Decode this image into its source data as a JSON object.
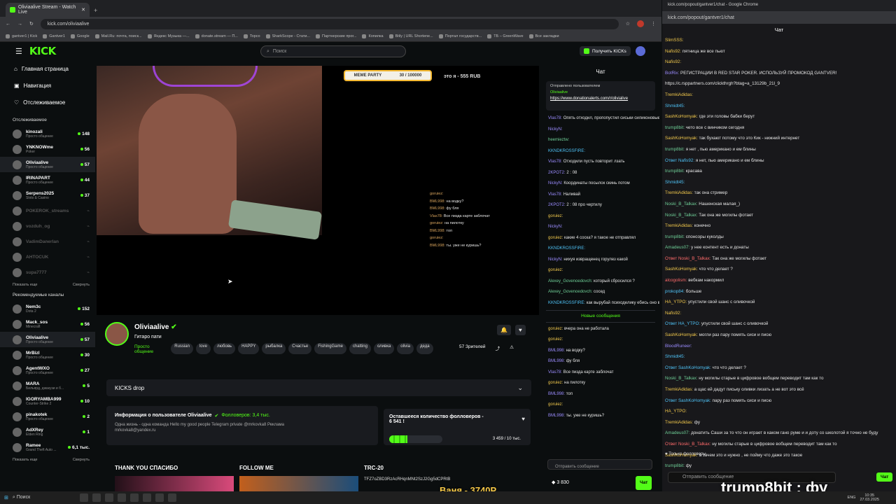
{
  "browser_left": {
    "tab_title": "Oliviaalive Stream - Watch Live",
    "url": "kick.com/oliviaalive",
    "bookmarks": [
      "gantver1 | Kick",
      "Gantver1",
      "Google",
      "Mail.Ru: почта, поиск...",
      "Яндекс Музыка —...",
      "donate.stream — П...",
      "Topco",
      "SharkScope - Стати...",
      "Партнерские прог...",
      "Копилка",
      "Bitly | URL Shortene...",
      "Портал государств...",
      "ТБ – GreenWave",
      "Все закладки"
    ]
  },
  "kick": {
    "logo": "KICK",
    "search_placeholder": "Поиск",
    "kicks_button": "Получить KICKs",
    "nav": [
      "Главная страница",
      "Навигация",
      "Отслеживаемое"
    ],
    "following_header": "Отслеживаемое",
    "following": [
      {
        "name": "kinozali",
        "cat": "Просто общение",
        "viewers": "148",
        "live": true
      },
      {
        "name": "YNKNOWme",
        "cat": "Poker",
        "viewers": "56",
        "live": true
      },
      {
        "name": "Oliviaalive",
        "cat": "Просто общение",
        "viewers": "57",
        "live": true,
        "sel": true
      },
      {
        "name": "IRINAPART",
        "cat": "Просто общение",
        "viewers": "44",
        "live": true
      },
      {
        "name": "Serpens2025",
        "cat": "Slots & Casino",
        "viewers": "37",
        "live": true
      },
      {
        "name": "POKEROK_streams",
        "cat": "",
        "viewers": "",
        "live": false
      },
      {
        "name": "vozduh_og",
        "cat": "",
        "viewers": "",
        "live": false
      },
      {
        "name": "VadimDanerlan",
        "cat": "",
        "viewers": "",
        "live": false
      },
      {
        "name": "AHTOCUK",
        "cat": "",
        "viewers": "",
        "live": false
      },
      {
        "name": "supa7777",
        "cat": "",
        "viewers": "",
        "live": false
      }
    ],
    "show_more": "Показать еще",
    "collapse": "Свернуть",
    "recommended_header": "Рекомендуемые каналы",
    "recommended": [
      {
        "name": "Nem3c",
        "cat": "Dota 2",
        "viewers": "152"
      },
      {
        "name": "Mack_sos",
        "cat": "Minecraft",
        "viewers": "56"
      },
      {
        "name": "Oliviaalive",
        "cat": "Просто общение",
        "viewers": "57",
        "sel": true
      },
      {
        "name": "MrBizl",
        "cat": "Просто общение",
        "viewers": "30"
      },
      {
        "name": "AgentWXO",
        "cat": "Просто общение",
        "viewers": "27"
      },
      {
        "name": "MARA",
        "cat": "Бильярд, джакузи и б...",
        "viewers": "5"
      },
      {
        "name": "IGORYAMBA999",
        "cat": "Counter-Strike 2",
        "viewers": "10"
      },
      {
        "name": "pinakotek",
        "cat": "Просто общение",
        "viewers": "2"
      },
      {
        "name": "AdXRey",
        "cat": "Elden Ring",
        "viewers": "1"
      },
      {
        "name": "Ramee",
        "cat": "Grand Theft Auto ...",
        "viewers": "6,1 тыс."
      }
    ],
    "show_more2": "Показать еще",
    "collapse2": "Свернуть"
  },
  "stream": {
    "overlay_top": "это я - 555 RUB",
    "meme": "MEME PARTY",
    "meme_sub": "30 / 100000",
    "overlay_chat": [
      [
        "goruiez:",
        ""
      ],
      [
        "BML998:",
        "на водку?"
      ],
      [
        "BML998:",
        "фу бля"
      ],
      [
        "Vlas78:",
        "Все пизда карте заблочат"
      ],
      [
        "goruiez:",
        "на пилотку"
      ],
      [
        "BML998:",
        "топ"
      ],
      [
        "goruiez:",
        ""
      ],
      [
        "BML998:",
        "ты. уже не куришь?"
      ]
    ],
    "channel": "Oliviaalive",
    "title": "Гитаро пати",
    "category": "Просто общение",
    "tags": [
      "Russian",
      "love",
      "любовь",
      "HAPPY",
      "рыбалка",
      "Счастье",
      "FishingGame",
      "chatting",
      "оливка",
      "olivia",
      "деда"
    ],
    "viewers": "57 Зрителей"
  },
  "panels": {
    "kicks_drop": "KICKS drop",
    "about_title": "Информация о пользователе Oliviaalive",
    "followers": "Фолловеров: 3,4 тыс.",
    "about_text1": "Одна жизнь - одна команда Hello my good people  Telegram private @mrkovka8 Реклама",
    "about_text2": "mrkovka8@yandex.ru",
    "goal_title": "Оставшееся количество фолловеров -",
    "goal_count": "6 541 !",
    "goal_progress_text": "3 459 / 10 тыс.",
    "goal_progress": 0.3459,
    "thank_you": "THANK YOU СПАСИБО",
    "follow_me": "FOLLOW ME",
    "trc": "TRC-20",
    "trc_addr": "TFZ7oZBD3RzAcRHqnMNt2SzJ2Gg5dCPRtB"
  },
  "chat": {
    "header": "Чат",
    "pinned_label": "Отправлено пользователем",
    "pinned_user": "Oliviaalive",
    "pinned_link": "https://www.donationalerts.com/r/olivialive",
    "lines": [
      [
        "Vlas78:",
        "Опять отходил, пропопустил сиськи силиконовые да ебано рот сто акое"
      ],
      [
        "NickyN:",
        ""
      ],
      [
        "heemieztw:",
        ""
      ],
      [
        "KKNDKROSSFIRE:",
        ""
      ],
      [
        "Vlas78:",
        "Отходили пусть повторит лзать"
      ],
      [
        "2KPOT2:",
        "2 : 08"
      ],
      [
        "NickyN:",
        "Координаты посылок скинь потом"
      ],
      [
        "Vlas78:",
        "Наливай"
      ],
      [
        "2KPOT2:",
        "2 : 08 про чертилу"
      ],
      [
        "goruiez:",
        ""
      ],
      [
        "NickyN:",
        ""
      ],
      [
        "goruiez:",
        "какие 4 соска? я такое не отправлял"
      ],
      [
        "KKNDKROSSFIRE:",
        ""
      ],
      [
        "NickyN:",
        "нихуя извращенец горулез какой"
      ],
      [
        "goruiez:",
        ""
      ],
      [
        "Alexey_Govenoedovch:",
        "который сбросился ?"
      ],
      [
        "Alexey_Govenoedovch:",
        "сосед"
      ],
      [
        "KKNDKROSSFIRE:",
        "как вырубай психоделику ебись оно все конем"
      ]
    ],
    "new_messages": "Новые сообщения",
    "lines2": [
      [
        "goruiez:",
        "вчера она не работала"
      ],
      [
        "goruiez:",
        ""
      ],
      [
        "BML998:",
        "на водку?"
      ],
      [
        "BML998:",
        "фу бля"
      ],
      [
        "Vlas78:",
        "Все пизда карте заблочат"
      ],
      [
        "goruiez:",
        "на пилотку"
      ],
      [
        "BML998:",
        "топ"
      ],
      [
        "goruiez:",
        ""
      ],
      [
        "BML998:",
        "ты. уже не куришь?"
      ]
    ],
    "send_placeholder": "Отправить сообщение",
    "balance": "3 830",
    "chat_button": "Чат"
  },
  "browser_right": {
    "url": "kick.com/popout/gantver1/chat",
    "title": "Чат",
    "lines": [
      [
        "SlimSSS:",
        ""
      ],
      [
        "Nafis92:",
        "пятница же все пьют"
      ],
      [
        "Nafis92:",
        ""
      ],
      [
        "BotRix:",
        "РЕГИСТРАЦИИ В RED STAR POKER. ИСПОЛЬЗУЙ ПРОМОКОД GANTVER!"
      ],
      [
        "",
        "https://c.rsppartners.com/clickthrgh?btag=a_13129b_21l_9"
      ],
      [
        "TremkiAdidas:",
        ""
      ],
      [
        "Shmidt45:",
        ""
      ],
      [
        "SashKoHomyak:",
        "где эти головы бабки берут"
      ],
      [
        "trump8bit:",
        "чето все с винчиком сегодня"
      ],
      [
        "SashKoHomyak:",
        "так бухают потому что это Кик - нижний интернет"
      ],
      [
        "trump8bit:",
        "я нет , пью американо и ем блины"
      ],
      [
        "Ответ Nafis92:",
        "я нет, пью американо и ем блины"
      ],
      [
        "trump8bit:",
        "красава"
      ],
      [
        "Shmidt45:",
        ""
      ],
      [
        "TremkiAdidas:",
        "так она стример"
      ],
      [
        "Noski_B_Talkax:",
        "Нашенская малая_)"
      ],
      [
        "Noski_B_Talkax:",
        "Так она же могилы фотает"
      ],
      [
        "TremkiAdidas:",
        "конечно"
      ],
      [
        "trump8bit:",
        "спонсоры куколды"
      ],
      [
        "Amadeus07:",
        "у нее контент есть и донаты"
      ],
      [
        "Ответ Noski_B_Talkax:",
        "Так она же могилы фотает"
      ],
      [
        "SashKoHomyak:",
        "что что делает ?"
      ],
      [
        "alcogolism:",
        "вебкам накормил"
      ],
      [
        "prokop84:",
        "больше"
      ],
      [
        "HA_YTPO:",
        "упустили свой шанс с оливочкой"
      ],
      [
        "Nafis92:",
        ""
      ],
      [
        "Ответ HA_YTPO:",
        "упустили свой шанс с оливочкой"
      ],
      [
        "SashKoHomyak:",
        "могли раз пару помять сиси и писю"
      ],
      [
        "BloodRuneer:",
        ""
      ],
      [
        "Shmidt45:",
        ""
      ],
      [
        "Ответ SashKoHomyak:",
        "что что делает ?"
      ],
      [
        "Noski_B_Talkax:",
        "ну могилы старые в цифровое вобщем переводит там как то"
      ],
      [
        "TremkiAdidas:",
        "а щас ей дадут письку оливки лизать а не вот это всё"
      ],
      [
        "Ответ SashKoHomyak:",
        "пару раз помять сиси и писю"
      ],
      [
        "HA_YTPO:",
        ""
      ],
      [
        "TremkiAdidas:",
        "фу"
      ],
      [
        "Amadeus07:",
        "донатить Саши за то что он играет в каком гано руме и и доту со школотой я точно не буду"
      ],
      [
        "Ответ Noski_B_Talkax:",
        "ну могилы старые в цифровое вобщем переводит там как то"
      ],
      [
        "SashKoHomyak:",
        "а зачем это и нужно , не пойму что даже это такое"
      ],
      [
        "trump8bit:",
        "фу"
      ]
    ],
    "followers_only": "Только фолловеры",
    "send_placeholder": "Отправить сообщение",
    "chat_button": "Чат",
    "overlay_text": "trump8bit : фу"
  },
  "taskbar": {
    "search": "Поиск",
    "clock_time": "10:35",
    "clock_date": "27.03.2025",
    "lang": "ENG"
  },
  "stream_overlay_bottom": "Ваня - 3740Р"
}
